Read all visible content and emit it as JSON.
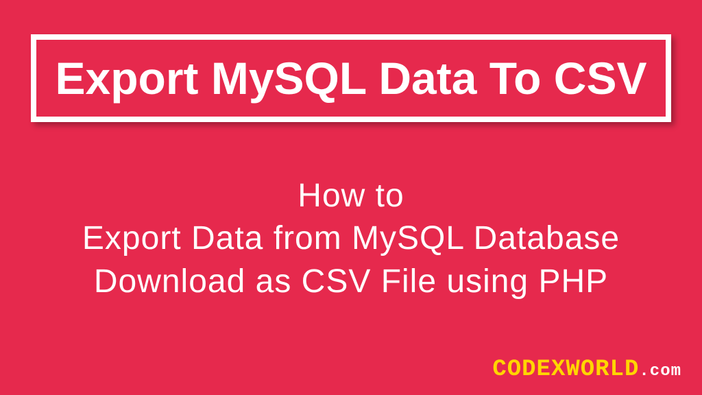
{
  "title": "Export MySQL Data To CSV",
  "subtitle": {
    "line1": "How to",
    "line2": "Export Data from MySQL Database",
    "line3": "Download as CSV File using PHP"
  },
  "watermark": {
    "main": "CODEXWORLD",
    "ext": ".com"
  },
  "colors": {
    "background": "#e6294d",
    "text": "#ffffff",
    "accent": "#ffd500"
  }
}
